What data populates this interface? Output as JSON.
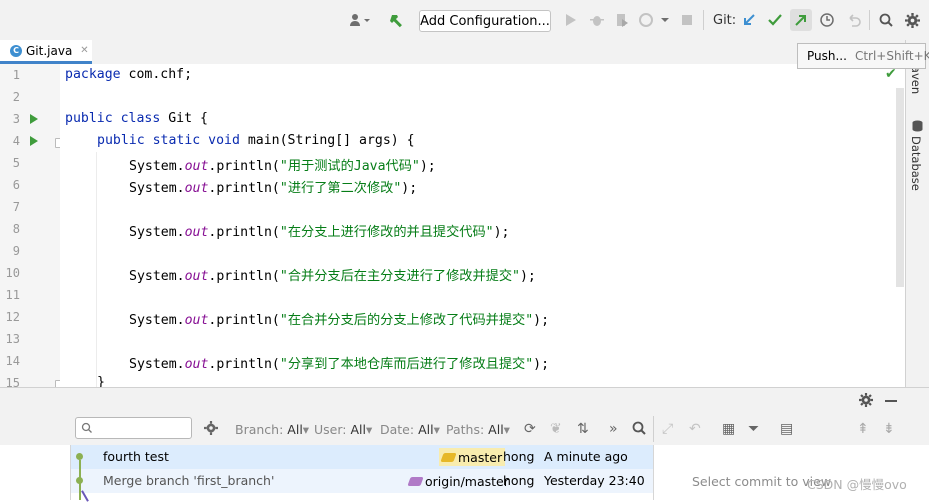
{
  "toolbar": {
    "add_configuration": "Add Configuration...",
    "git_label": "Git:"
  },
  "tooltip": {
    "action": "Push...",
    "shortcut": "Ctrl+Shift+K"
  },
  "tab": {
    "file_name": "Git.java"
  },
  "right_stripe": {
    "maven": "Maven",
    "database": "Database"
  },
  "editor": {
    "lines": [
      {
        "num": "1"
      },
      {
        "num": "2"
      },
      {
        "num": "3"
      },
      {
        "num": "4"
      },
      {
        "num": "5"
      },
      {
        "num": "6"
      },
      {
        "num": "7"
      },
      {
        "num": "8"
      },
      {
        "num": "9"
      },
      {
        "num": "10"
      },
      {
        "num": "11"
      },
      {
        "num": "12"
      },
      {
        "num": "13"
      },
      {
        "num": "14"
      },
      {
        "num": "15"
      }
    ],
    "code": {
      "l1_kw": "package",
      "l1_rest": " com.chf;",
      "l3_kw": "public class",
      "l3_rest": " Git {",
      "l4_kw": "public static void",
      "l4_rest": " main(String[] args) {",
      "out": "out",
      "sys": "System.",
      "println": ".println(",
      "close": ");",
      "s5": "\"用于测试的Java代码\"",
      "s6": "\"进行了第二次修改\"",
      "s8": "\"在分支上进行修改的并且提交代码\"",
      "s10": "\"合并分支后在主分支进行了修改并提交\"",
      "s12": "\"在合并分支后的分支上修改了代码并提交\"",
      "s14": "\"分享到了本地仓库而后进行了修改且提交\"",
      "l15": "}"
    }
  },
  "log": {
    "filters": {
      "branch": {
        "label": "Branch:",
        "value": "All"
      },
      "user": {
        "label": "User:",
        "value": "All"
      },
      "date": {
        "label": "Date:",
        "value": "All"
      },
      "paths": {
        "label": "Paths:",
        "value": "All"
      }
    },
    "commits": [
      {
        "message": "fourth test",
        "ref": "master",
        "author": "hong",
        "date": "A minute ago"
      },
      {
        "message": "Merge branch 'first_branch'",
        "ref": "origin/master",
        "author": "hong",
        "date": "Yesterday 23:40"
      }
    ],
    "details_placeholder": "Select commit to view"
  },
  "watermark": "CSDN @慢慢ovo",
  "colors": {
    "accent": "#4083c9",
    "run_green": "#3f9c3c",
    "keyword": "#0a2bb0",
    "string": "#067d17",
    "field": "#871094",
    "selected_row": "#dcecfd"
  }
}
